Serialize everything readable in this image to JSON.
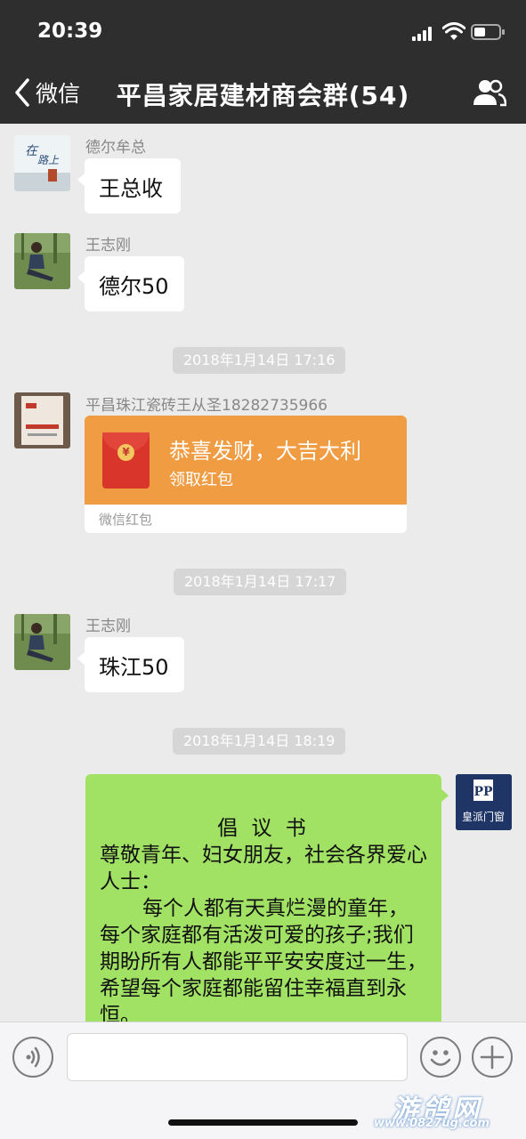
{
  "status_bar": {
    "time": "20:39"
  },
  "header": {
    "back_label": "微信",
    "title": "平昌家居建材商会群(54)"
  },
  "messages": [
    {
      "sender": "德尔牟总",
      "text": "王总收"
    },
    {
      "sender": "王志刚",
      "text": "德尔50"
    },
    {
      "timestamp": "2018年1月14日 17:16"
    },
    {
      "sender": "平昌珠江瓷砖王从圣18282735966",
      "red_packet": {
        "title": "恭喜发财，大吉大利",
        "subtitle": "领取红包",
        "footer": "微信红包"
      }
    },
    {
      "timestamp": "2018年1月14日 17:17"
    },
    {
      "sender": "王志刚",
      "text": "珠江50"
    },
    {
      "timestamp": "2018年1月14日 18:19"
    }
  ],
  "outgoing": {
    "avatar_text": "皇派门窗",
    "lines": [
      "倡 议 书",
      "尊敬青年、妇女朋友，社会各界爱心人士：",
      "每个人都有天真烂漫的童年，每个家庭都有活泼可爱的孩子;我们期盼所有人都能平平安安度过一生，希望每个家庭都能留住幸福直到永恒。"
    ]
  },
  "watermark": {
    "name": "游鸽网",
    "url": "www.0827ug.com"
  },
  "colors": {
    "header_bg": "#2e2e2e",
    "chat_bg": "#ebebeb",
    "outgoing_bubble": "#a1e265",
    "red_packet": "#f09c42"
  }
}
